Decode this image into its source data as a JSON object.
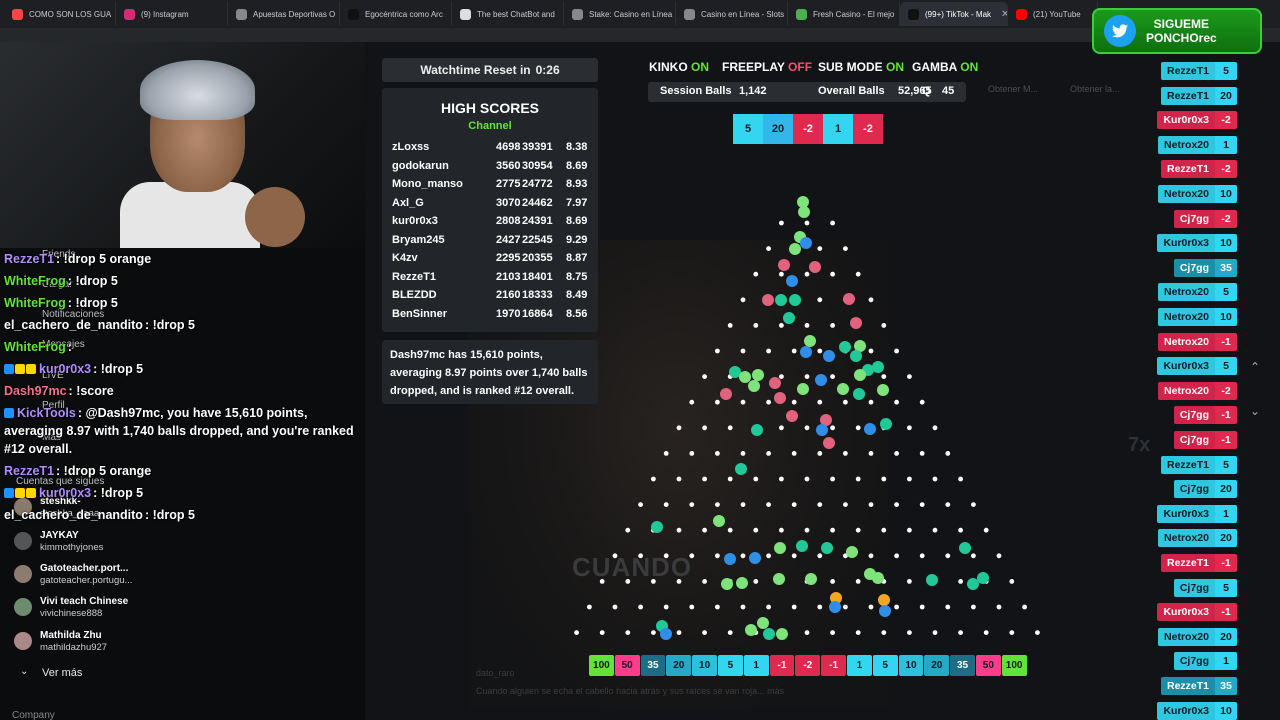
{
  "browser": {
    "tabs": [
      {
        "label": "COMO SON LOS GUA",
        "color": "#ff4444"
      },
      {
        "label": "(9) Instagram",
        "color": "#d62976"
      },
      {
        "label": "Apuestas Deportivas O",
        "color": "#888888"
      },
      {
        "label": "Egocéntrica como Arc",
        "color": "#111111"
      },
      {
        "label": "The best ChatBot and",
        "color": "#dddddd"
      },
      {
        "label": "Stake: Casino en Línea",
        "color": "#888888"
      },
      {
        "label": "Casino en Línea - Slots",
        "color": "#888888"
      },
      {
        "label": "Fresh Casino - El mejo",
        "color": "#4caf50"
      },
      {
        "label": "(99+) TikTok - Mak",
        "color": "#111111",
        "active": true
      },
      {
        "label": "(21) YouTube",
        "color": "#ff0000"
      }
    ]
  },
  "twitter": {
    "line1": "SIGUEME",
    "line2": "PONCHOrec"
  },
  "chat": [
    {
      "user": "RezzeT1",
      "ucolor": "#b18cff",
      "msg": "!drop 5 orange",
      "badges": []
    },
    {
      "user": "WhiteFrog",
      "ucolor": "#62e33a",
      "msg": "!drop 5",
      "badges": []
    },
    {
      "user": "WhiteFrog",
      "ucolor": "#62e33a",
      "msg": "!drop 5",
      "badges": []
    },
    {
      "user": "el_cachero_de_nandito",
      "ucolor": "#ffffff",
      "msg": "!drop 5",
      "badges": []
    },
    {
      "user": "WhiteFrog",
      "ucolor": "#62e33a",
      "msg": "",
      "badges": []
    },
    {
      "user": "kur0r0x3",
      "ucolor": "#b18cff",
      "msg": "!drop 5",
      "badges": [
        "#1e90ff",
        "#ffd700",
        "#ffd700"
      ]
    },
    {
      "user": "Dash97mc",
      "ucolor": "#ff6b8b",
      "msg": "!score",
      "badges": []
    },
    {
      "user": "KickTools",
      "ucolor": "#b18cff",
      "msg": "@Dash97mc, you have 15,610 points,",
      "badges": [
        "#1e90ff"
      ]
    },
    {
      "user": "",
      "ucolor": "#ffffff",
      "msg": "averaging 8.97 with 1,740 balls dropped, and you're ranked",
      "badges": []
    },
    {
      "user": "",
      "ucolor": "#ffffff",
      "msg": "#12 overall.",
      "badges": []
    },
    {
      "user": "RezzeT1",
      "ucolor": "#b18cff",
      "msg": "!drop 5 orange",
      "badges": []
    },
    {
      "user": "kur0r0x3",
      "ucolor": "#b18cff",
      "msg": "!drop 5",
      "badges": [
        "#1e90ff",
        "#ffd700",
        "#ffd700"
      ]
    },
    {
      "user": "el_cachero_de_nandito",
      "ucolor": "#ffffff",
      "msg": "!drop 5",
      "badges": []
    }
  ],
  "kick_sidebar": {
    "items": [
      "Friends",
      "Cargar",
      "Notificaciones",
      "Mensajes",
      "LIVE",
      "Perfil",
      "Más",
      "Cuentas que sigues"
    ],
    "following": [
      {
        "name": "steshkk-",
        "user": "steshka_aaaa"
      },
      {
        "name": "JAYKAY",
        "user": "kimmothyjones"
      },
      {
        "name": "Gatoteacher.port...",
        "user": "gatoteacher.portugu..."
      },
      {
        "name": "Vivi teach Chinese",
        "user": "vivichinese888"
      },
      {
        "name": "Mathilda Zhu",
        "user": "mathildazhu927"
      }
    ],
    "see_more": "Ver más",
    "company": "Company"
  },
  "game": {
    "timer_label": "Watchtime Reset in",
    "timer_value": "0:26",
    "high_scores_title": "HIGH SCORES",
    "high_scores_sub": "Channel",
    "scores": [
      {
        "name": "zLoxss",
        "a": "4698",
        "b": "39391",
        "c": "8.38"
      },
      {
        "name": "godokarun",
        "a": "3560",
        "b": "30954",
        "c": "8.69"
      },
      {
        "name": "Mono_manso",
        "a": "2775",
        "b": "24772",
        "c": "8.93"
      },
      {
        "name": "Axl_G",
        "a": "3070",
        "b": "24462",
        "c": "7.97"
      },
      {
        "name": "kur0r0x3",
        "a": "2808",
        "b": "24391",
        "c": "8.69"
      },
      {
        "name": "Bryam245",
        "a": "2427",
        "b": "22545",
        "c": "9.29"
      },
      {
        "name": "K4zv",
        "a": "2295",
        "b": "20355",
        "c": "8.87"
      },
      {
        "name": "RezzeT1",
        "a": "2103",
        "b": "18401",
        "c": "8.75"
      },
      {
        "name": "BLEZDD",
        "a": "2160",
        "b": "18333",
        "c": "8.49"
      },
      {
        "name": "BenSinner",
        "a": "1970",
        "b": "16864",
        "c": "8.56"
      }
    ],
    "info": "Dash97mc has 15,610 points, averaging 8.97 points over 1,740 balls dropped, and is ranked #12 overall.",
    "status": [
      {
        "label": "KINKO",
        "state": "ON"
      },
      {
        "label": "FREEPLAY",
        "state": "OFF"
      },
      {
        "label": "SUB MODE",
        "state": "ON"
      },
      {
        "label": "GAMBA",
        "state": "ON"
      }
    ],
    "session_label": "Session Balls",
    "session_value": "1,142",
    "overall_label": "Overall Balls",
    "overall_value": "52,965",
    "q_label": "Q",
    "q_value": "45",
    "recent_drops": [
      {
        "v": "5",
        "kind": "cyan"
      },
      {
        "v": "20",
        "kind": "blue"
      },
      {
        "v": "-2",
        "kind": "red"
      },
      {
        "v": "1",
        "kind": "cyan"
      },
      {
        "v": "-2",
        "kind": "red"
      }
    ],
    "bins": [
      {
        "v": "100",
        "color": "#62e33a"
      },
      {
        "v": "50",
        "color": "#ff3d8b"
      },
      {
        "v": "35",
        "color": "#1c6d85"
      },
      {
        "v": "20",
        "color": "#24a9c6"
      },
      {
        "v": "10",
        "color": "#2bc0dc"
      },
      {
        "v": "5",
        "color": "#33d6f0"
      },
      {
        "v": "1",
        "color": "#33d6f0"
      },
      {
        "v": "-1",
        "color": "#e0294e"
      },
      {
        "v": "-2",
        "color": "#e0294e"
      },
      {
        "v": "-1",
        "color": "#e0294e"
      },
      {
        "v": "1",
        "color": "#33d6f0"
      },
      {
        "v": "5",
        "color": "#33d6f0"
      },
      {
        "v": "10",
        "color": "#2bc0dc"
      },
      {
        "v": "20",
        "color": "#24a9c6"
      },
      {
        "v": "35",
        "color": "#1c6d85"
      },
      {
        "v": "50",
        "color": "#ff3d8b"
      },
      {
        "v": "100",
        "color": "#62e33a"
      }
    ],
    "bin_light_text": [
      "100",
      "35",
      "-1",
      "-2"
    ],
    "background_text": "CUANDO",
    "background_sub1": "dato_raro",
    "background_sub2": "Cuando alguien se echa el cabello hacia atrás y sus raíces se van roja... más",
    "background_7x": "7x",
    "background_btn1": "Obtener M...",
    "background_btn2": "Obtener la..."
  },
  "feed": [
    {
      "name": "RezzeT1",
      "val": "5",
      "kind": "pos"
    },
    {
      "name": "RezzeT1",
      "val": "20",
      "kind": "pos"
    },
    {
      "name": "Kur0r0x3",
      "val": "-2",
      "kind": "neg"
    },
    {
      "name": "Netrox20",
      "val": "1",
      "kind": "pos"
    },
    {
      "name": "RezzeT1",
      "val": "-2",
      "kind": "neg"
    },
    {
      "name": "Netrox20",
      "val": "10",
      "kind": "pos"
    },
    {
      "name": "Cj7gg",
      "val": "-2",
      "kind": "neg"
    },
    {
      "name": "Kur0r0x3",
      "val": "10",
      "kind": "pos"
    },
    {
      "name": "Cj7gg",
      "val": "35",
      "kind": "big"
    },
    {
      "name": "Netrox20",
      "val": "5",
      "kind": "pos"
    },
    {
      "name": "Netrox20",
      "val": "10",
      "kind": "pos"
    },
    {
      "name": "Netrox20",
      "val": "-1",
      "kind": "neg"
    },
    {
      "name": "Kur0r0x3",
      "val": "5",
      "kind": "pos"
    },
    {
      "name": "Netrox20",
      "val": "-2",
      "kind": "neg"
    },
    {
      "name": "Cj7gg",
      "val": "-1",
      "kind": "neg"
    },
    {
      "name": "Cj7gg",
      "val": "-1",
      "kind": "neg"
    },
    {
      "name": "RezzeT1",
      "val": "5",
      "kind": "pos"
    },
    {
      "name": "Cj7gg",
      "val": "20",
      "kind": "pos"
    },
    {
      "name": "Kur0r0x3",
      "val": "1",
      "kind": "pos"
    },
    {
      "name": "Netrox20",
      "val": "20",
      "kind": "pos"
    },
    {
      "name": "RezzeT1",
      "val": "-1",
      "kind": "neg"
    },
    {
      "name": "Cj7gg",
      "val": "5",
      "kind": "pos"
    },
    {
      "name": "Kur0r0x3",
      "val": "-1",
      "kind": "neg"
    },
    {
      "name": "Netrox20",
      "val": "20",
      "kind": "pos"
    },
    {
      "name": "Cj7gg",
      "val": "1",
      "kind": "pos"
    },
    {
      "name": "RezzeT1",
      "val": "35",
      "kind": "big"
    },
    {
      "name": "Kur0r0x3",
      "val": "10",
      "kind": "pos"
    }
  ],
  "ball_colors": {
    "green": "#7ee37a",
    "blue": "#2f8fe8",
    "pink": "#e2627e",
    "teal": "#20c997",
    "orange": "#f5a623"
  },
  "accent_on": "#62e33a",
  "accent_off": "#ff4d6d"
}
